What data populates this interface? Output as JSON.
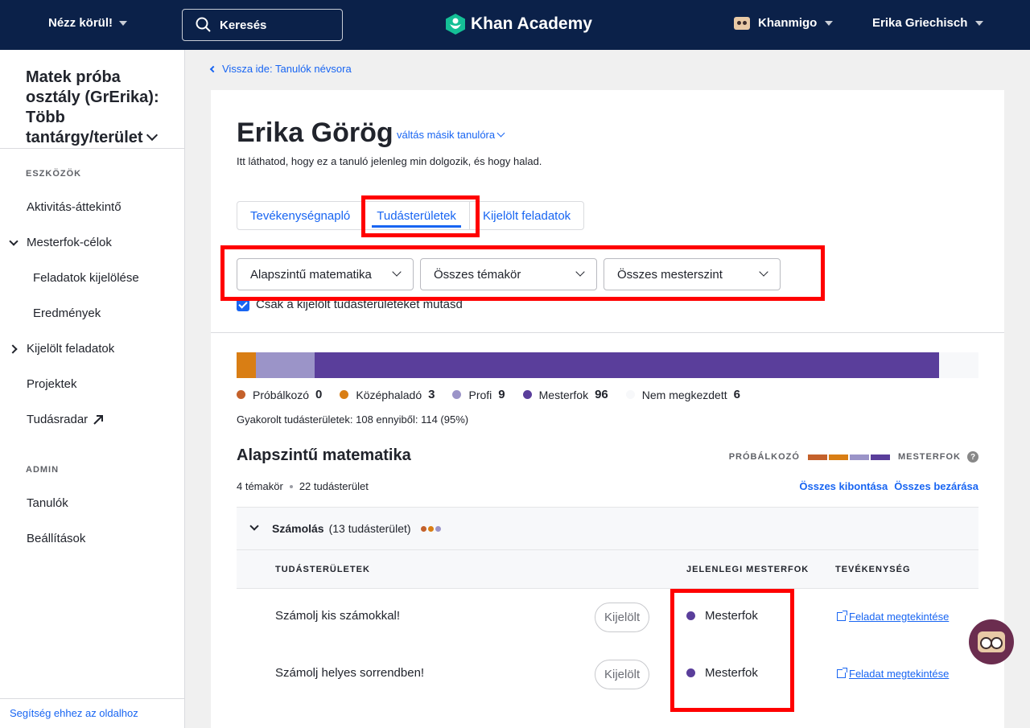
{
  "nav": {
    "explore_label": "Nézz körül!",
    "search_placeholder": "Keresés",
    "logo_text": "Khan Academy",
    "khanmigo_label": "Khanmigo",
    "user_name": "Erika Griechisch"
  },
  "sidebar": {
    "class_title": "Matek próba osztály (GrErika): Több tantárgy/terület",
    "tools_heading": "ESZKÖZÖK",
    "items": [
      {
        "label": "Aktivitás-áttekintő"
      },
      {
        "label": "Mesterfok-célok"
      },
      {
        "label": "Feladatok kijelölése"
      },
      {
        "label": "Eredmények"
      },
      {
        "label": "Kijelölt feladatok"
      },
      {
        "label": "Projektek"
      },
      {
        "label": "Tudásradar"
      }
    ],
    "admin_heading": "ADMIN",
    "admin_items": [
      {
        "label": "Tanulók"
      },
      {
        "label": "Beállítások"
      }
    ],
    "help_link": "Segítség ehhez az oldalhoz"
  },
  "main": {
    "back_link": "Vissza ide: Tanulók névsora",
    "student_name": "Erika Görög",
    "switch_link": "váltás másik tanulóra",
    "subtitle": "Itt láthatod, hogy ez a tanuló jelenleg min dolgozik, és hogy halad.",
    "tabs": [
      {
        "label": "Tevékenységnapló",
        "active": false
      },
      {
        "label": "Tudásterületek",
        "active": true
      },
      {
        "label": "Kijelölt feladatok",
        "active": false
      }
    ],
    "filters": {
      "course": "Alapszintű matematika",
      "unit": "Összes témakör",
      "mastery": "Összes mesterszint"
    },
    "checkbox_label": "Csak a kijelölt tudásterületeket mutasd",
    "checkbox_checked": true,
    "progress": {
      "segments": [
        {
          "name": "Középhaladó",
          "count": 3,
          "color": "#d97e14"
        },
        {
          "name": "Profi",
          "count": 9,
          "color": "#9b94c8"
        },
        {
          "name": "Mesterfok",
          "count": 96,
          "color": "#5a3e9b"
        },
        {
          "name": "Nem megkezdett",
          "count": 6,
          "color": "#f7f8fa"
        }
      ],
      "total": 114
    },
    "legend": [
      {
        "label": "Próbálkozó",
        "count": "0",
        "color": "#c4612b"
      },
      {
        "label": "Középhaladó",
        "count": "3",
        "color": "#d97e14"
      },
      {
        "label": "Profi",
        "count": "9",
        "color": "#9b94c8"
      },
      {
        "label": "Mesterfok",
        "count": "96",
        "color": "#5a3e9b"
      },
      {
        "label": "Nem megkezdett",
        "count": "6",
        "color": "#f7f8fa"
      }
    ],
    "practiced_text": "Gyakorolt tudásterületek: 108 ennyiből: 114 (95%)",
    "section_title": "Alapszintű matematika",
    "scale_low": "PRÓBÁLKOZÓ",
    "scale_high": "MESTERFOK",
    "scale_colors": [
      "#c4612b",
      "#d97e14",
      "#9b94c8",
      "#5a3e9b"
    ],
    "unit_count": "4 témakör",
    "skill_count": "22 tudásterület",
    "expand_all": "Összes kibontása",
    "collapse_all": "Összes bezárása",
    "group": {
      "name": "Számolás",
      "count": "(13 tudásterület)",
      "dot_colors": [
        "#c4612b",
        "#d97e14",
        "#9b94c8"
      ]
    },
    "table_headers": {
      "skills": "TUDÁSTERÜLETEK",
      "mastery": "JELENLEGI MESTERFOK",
      "activity": "TEVÉKENYSÉG"
    },
    "rows": [
      {
        "skill": "Számolj kis számokkal!",
        "badge": "Kijelölt",
        "mastery": "Mesterfok",
        "mastery_color": "#5a3e9b",
        "activity": "Feladat megtekintése"
      },
      {
        "skill": "Számolj helyes sorrendben!",
        "badge": "Kijelölt",
        "mastery": "Mesterfok",
        "mastery_color": "#5a3e9b",
        "activity": "Feladat megtekintése"
      }
    ]
  }
}
